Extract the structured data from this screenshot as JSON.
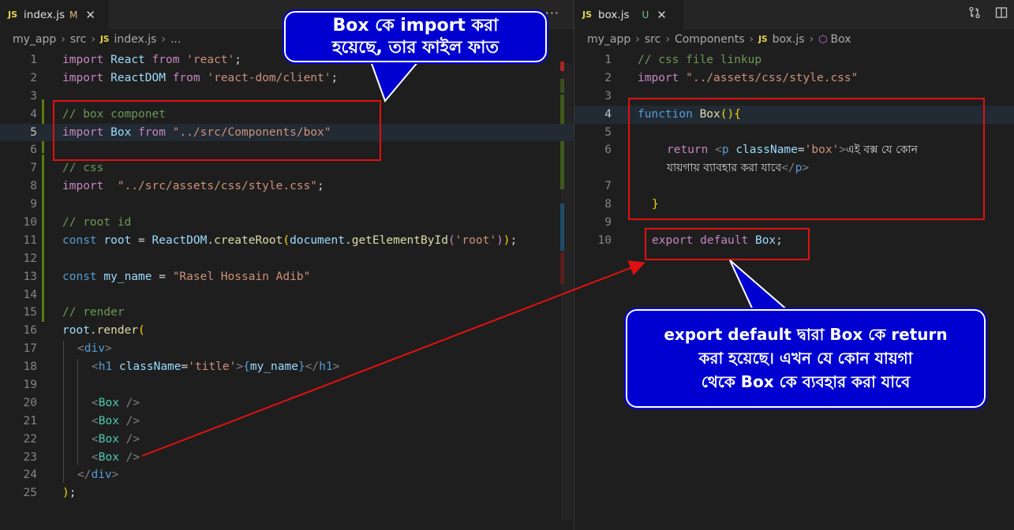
{
  "left_editor": {
    "tab": {
      "icon": "JS",
      "filename": "index.js",
      "status": "M",
      "close": "✕"
    },
    "more_actions": "···",
    "breadcrumb": {
      "root": "my_app",
      "folder": "src",
      "icon": "JS",
      "file": "index.js",
      "tail": "..."
    },
    "lines": [
      {
        "n": "1"
      },
      {
        "n": "2"
      },
      {
        "n": "3"
      },
      {
        "n": "4"
      },
      {
        "n": "5"
      },
      {
        "n": "6"
      },
      {
        "n": "7"
      },
      {
        "n": "8"
      },
      {
        "n": "9"
      },
      {
        "n": "10"
      },
      {
        "n": "11"
      },
      {
        "n": "12"
      },
      {
        "n": "13"
      },
      {
        "n": "14"
      },
      {
        "n": "15"
      },
      {
        "n": "16"
      },
      {
        "n": "17"
      },
      {
        "n": "18"
      },
      {
        "n": "19"
      },
      {
        "n": "20"
      },
      {
        "n": "21"
      },
      {
        "n": "22"
      },
      {
        "n": "23"
      },
      {
        "n": "24"
      },
      {
        "n": "25"
      }
    ],
    "code": {
      "l1": [
        "import",
        " ",
        "React",
        " ",
        "from",
        " ",
        "'react'",
        ";"
      ],
      "l2": [
        "import",
        " ",
        "ReactDOM",
        " ",
        "from",
        " ",
        "'react-dom/client'",
        ";"
      ],
      "l4": "// box componet",
      "l5": [
        "import",
        " ",
        "Box",
        " ",
        "from",
        " ",
        "\"../src/Components/box\""
      ],
      "l7": "// css",
      "l8": [
        "import",
        "  ",
        "\"../src/assets/css/style.css\"",
        ";"
      ],
      "l10": "// root id",
      "l11": [
        "const",
        " ",
        "root",
        " = ",
        "ReactDOM",
        ".",
        "createRoot",
        "(",
        "document",
        ".",
        "getElementById",
        "(",
        "'root'",
        ")",
        ")",
        ";"
      ],
      "l13": [
        "const",
        " ",
        "my_name",
        " = ",
        "\"Rasel Hossain Adib\""
      ],
      "l15": "// render",
      "l16": [
        "root",
        ".",
        "render",
        "("
      ],
      "l17": [
        "<",
        "div",
        ">"
      ],
      "l18": [
        "<",
        "h1",
        " ",
        "className",
        "=",
        "'title'",
        ">",
        "{",
        "my_name",
        "}",
        "</",
        "h1",
        ">"
      ],
      "l20": [
        "<",
        "Box",
        " />"
      ],
      "l21": [
        "<",
        "Box",
        " />"
      ],
      "l22": [
        "<",
        "Box",
        " />"
      ],
      "l23": [
        "<",
        "Box",
        " />"
      ],
      "l24": [
        "</",
        "div",
        ">"
      ],
      "l25": [
        ")",
        ";"
      ]
    }
  },
  "right_editor": {
    "tab": {
      "icon": "JS",
      "filename": "box.js",
      "status": "U",
      "close": "✕"
    },
    "breadcrumb": {
      "root": "my_app",
      "folder1": "src",
      "folder2": "Components",
      "icon": "JS",
      "file": "box.js",
      "symbol": "Box"
    },
    "lines": [
      {
        "n": "1"
      },
      {
        "n": "2"
      },
      {
        "n": "3"
      },
      {
        "n": "4"
      },
      {
        "n": "5"
      },
      {
        "n": "6"
      },
      {
        "n": ""
      },
      {
        "n": "7"
      },
      {
        "n": "8"
      },
      {
        "n": "9"
      },
      {
        "n": "10"
      }
    ],
    "code": {
      "l1": "// css file linkup",
      "l2": [
        "import",
        " ",
        "\"../assets/css/style.css\""
      ],
      "l4": [
        "function",
        " ",
        "Box",
        "(",
        ")",
        "{"
      ],
      "l6a": [
        "return",
        " ",
        "<",
        "p",
        " ",
        "className",
        "=",
        "'box'",
        ">",
        "এই বক্স যে কোন"
      ],
      "l6b": [
        "যায়গায় ব্যাবহার করা যাবে",
        "</",
        "p",
        ">"
      ],
      "l8": "}",
      "l10": [
        "export",
        " ",
        "default",
        " ",
        "Box",
        ";"
      ]
    }
  },
  "annotations": {
    "top_callout": {
      "line1": "Box কে import করা",
      "line2": "হয়েছে, তার ফাইল ফাত"
    },
    "bottom_callout": {
      "line1": "export default দ্বারা Box কে return",
      "line2": "করা হয়েছে। এখন যে কোন যায়গা",
      "line3": "থেকে Box কে ব্যবহার করা যাবে"
    }
  },
  "colors": {
    "editor_bg": "#1e1e1e",
    "highlight_red": "#e01010",
    "callout_blue": "#0000d0",
    "gutter_added": "#587c0c"
  }
}
